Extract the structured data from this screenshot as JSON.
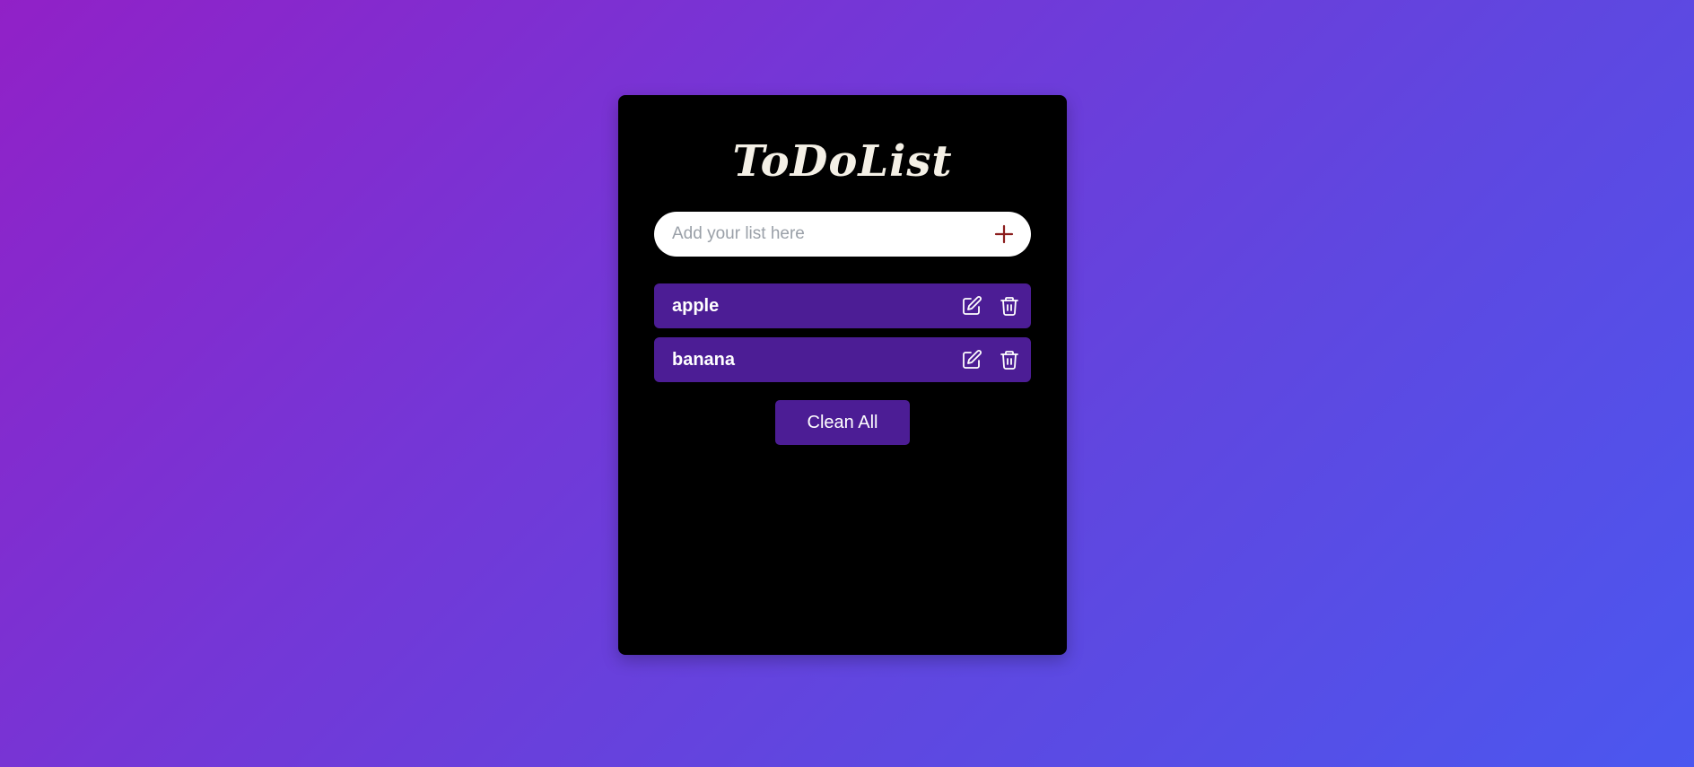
{
  "app": {
    "title": "ToDoList"
  },
  "input": {
    "placeholder": "Add your list here",
    "value": "",
    "add_icon": "plus-icon"
  },
  "items": [
    {
      "label": "apple",
      "edit_icon": "edit-icon",
      "delete_icon": "trash-icon"
    },
    {
      "label": "banana",
      "edit_icon": "edit-icon",
      "delete_icon": "trash-icon"
    }
  ],
  "actions": {
    "clean_all_label": "Clean All"
  },
  "colors": {
    "background_gradient_start": "#9121c7",
    "background_gradient_end": "#4b57ef",
    "card": "#000000",
    "item_bg": "#4c1d95",
    "add_icon": "#8b1c1c",
    "title": "#f4f0e6"
  }
}
